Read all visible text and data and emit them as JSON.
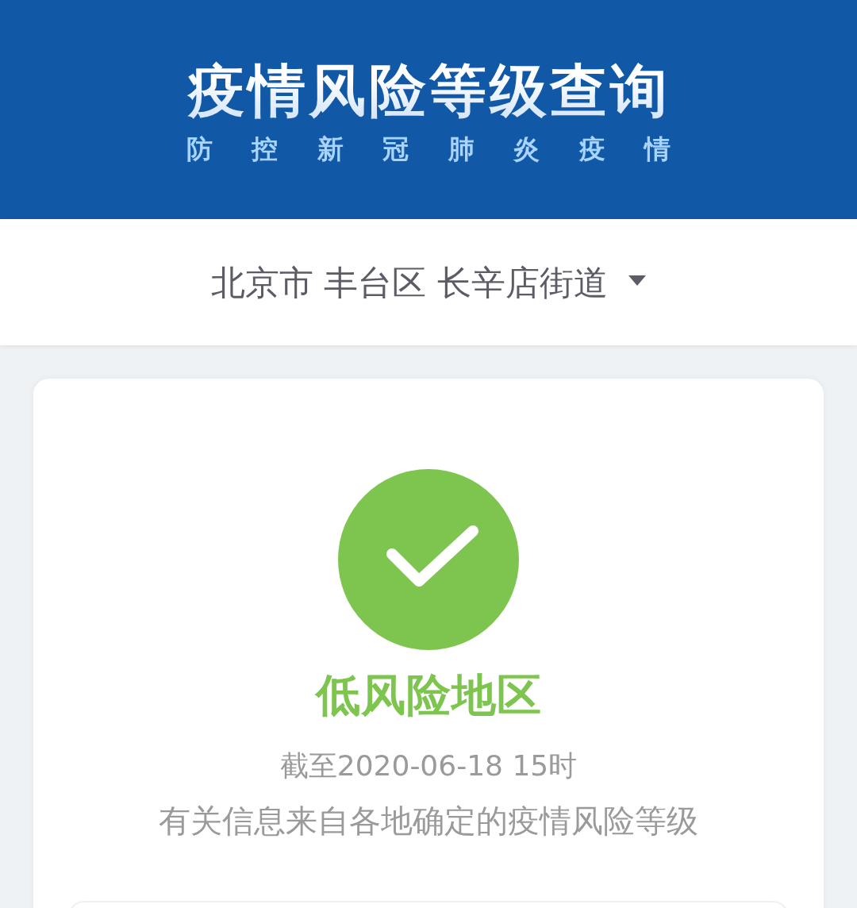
{
  "header": {
    "title": "疫情风险等级查询",
    "subtitle": "防控新冠肺炎疫情"
  },
  "location_select": {
    "value": "北京市 丰台区 长辛店街道"
  },
  "result": {
    "kind": "low",
    "status": "低风险地区",
    "updated": "截至2020-06-18 15时",
    "note": "有关信息来自各地确定的疫情风险等级"
  }
}
